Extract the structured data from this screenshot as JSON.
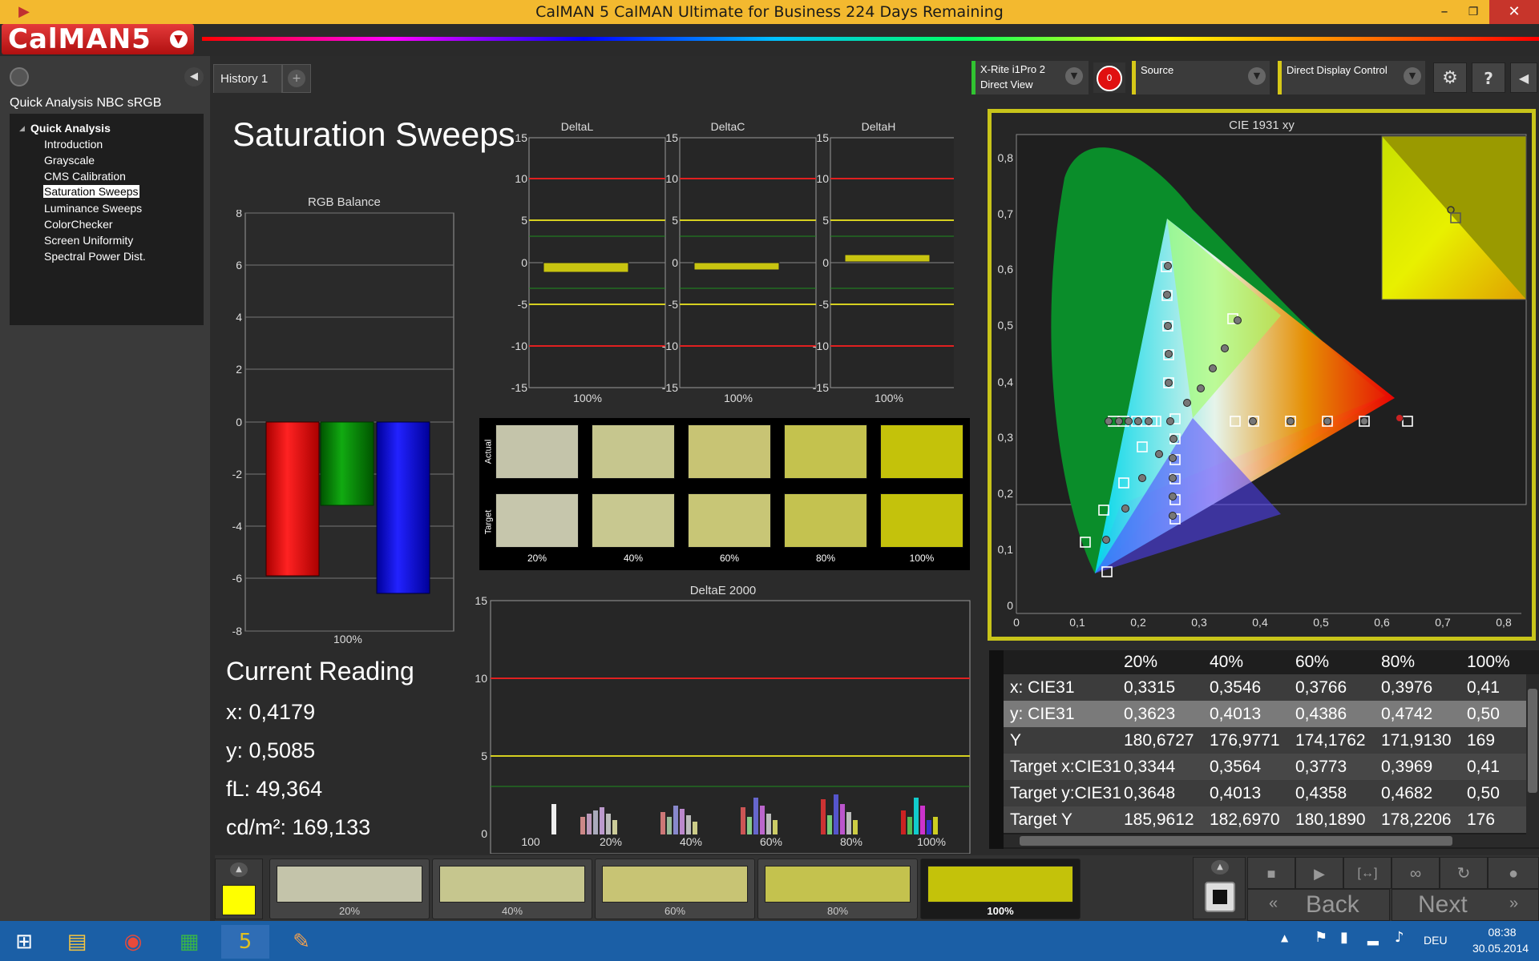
{
  "window": {
    "title": "CalMAN 5 CalMAN Ultimate for Business 224 Days Remaining",
    "minimize": "–",
    "restore": "❐",
    "close": "✕"
  },
  "logo": {
    "text": "CalMAN5"
  },
  "sidebar": {
    "title": "Quick Analysis NBC sRGB",
    "root": "Quick Analysis",
    "items": [
      "Introduction",
      "Grayscale",
      "CMS Calibration",
      "Saturation Sweeps",
      "Luminance Sweeps",
      "ColorChecker",
      "Screen Uniformity",
      "Spectral Power Dist."
    ],
    "selected": 3
  },
  "tabs": {
    "history": "History 1",
    "add": "+"
  },
  "toolbar": {
    "meter_line1": "X-Rite i1Pro 2",
    "meter_line2": "Direct View",
    "meter_count": "0",
    "source": "Source",
    "display": "Direct Display Control"
  },
  "page_title": "Saturation Sweeps",
  "rgb_balance": {
    "title": "RGB Balance",
    "xlabel": "100%",
    "yticks": [
      "8",
      "6",
      "4",
      "2",
      "0",
      "-2",
      "-4",
      "-6",
      "-8"
    ]
  },
  "delta_charts": [
    {
      "title": "DeltaL",
      "xlabel": "100%"
    },
    {
      "title": "DeltaC",
      "xlabel": "100%"
    },
    {
      "title": "DeltaH",
      "xlabel": "100%"
    }
  ],
  "delta_yticks": [
    "15",
    "10",
    "5",
    "0",
    "-5",
    "-10",
    "-15"
  ],
  "swatches": {
    "row_actual": "Actual",
    "row_target": "Target",
    "labels": [
      "20%",
      "40%",
      "60%",
      "80%",
      "100%"
    ],
    "actual": [
      "#c4c4aa",
      "#c6c68e",
      "#c8c474",
      "#c4c24e",
      "#c4c20a"
    ],
    "target": [
      "#c6c6ac",
      "#c8c890",
      "#c8c676",
      "#c4c250",
      "#c4c20c"
    ]
  },
  "deltae": {
    "title": "DeltaE 2000",
    "yticks": [
      "15",
      "10",
      "5",
      "0"
    ],
    "xlabels": [
      "100",
      "20%",
      "40%",
      "60%",
      "80%",
      "100%"
    ]
  },
  "cie": {
    "title": "CIE 1931 xy",
    "xticks": [
      "0",
      "0,1",
      "0,2",
      "0,3",
      "0,4",
      "0,5",
      "0,6",
      "0,7",
      "0,8"
    ],
    "yticks": [
      "0,8",
      "0,7",
      "0,6",
      "0,5",
      "0,4",
      "0,3",
      "0,2",
      "0,1",
      "0"
    ]
  },
  "current_reading": {
    "title": "Current Reading",
    "x": "x: 0,4179",
    "y": "y: 0,5085",
    "fl": "fL: 49,364",
    "cd": "cd/m²: 169,133"
  },
  "table": {
    "headers": [
      "",
      "20%",
      "40%",
      "60%",
      "80%",
      "100%"
    ],
    "rows": [
      [
        "x: CIE31",
        "0,3315",
        "0,3546",
        "0,3766",
        "0,3976",
        "0,41"
      ],
      [
        "y: CIE31",
        "0,3623",
        "0,4013",
        "0,4386",
        "0,4742",
        "0,50"
      ],
      [
        "Y",
        "180,6727",
        "176,9771",
        "174,1762",
        "171,9130",
        "169"
      ],
      [
        "Target x:CIE31",
        "0,3344",
        "0,3564",
        "0,3773",
        "0,3969",
        "0,41"
      ],
      [
        "Target y:CIE31",
        "0,3648",
        "0,4013",
        "0,4358",
        "0,4682",
        "0,50"
      ],
      [
        "Target Y",
        "185,9612",
        "182,6970",
        "180,1890",
        "178,2206",
        "176"
      ]
    ]
  },
  "bottom": {
    "swatches": [
      "20%",
      "40%",
      "60%",
      "80%",
      "100%"
    ],
    "back": "Back",
    "next": "Next"
  },
  "taskbar": {
    "time": "08:38",
    "date": "30.05.2014",
    "lang": "DEU"
  }
}
